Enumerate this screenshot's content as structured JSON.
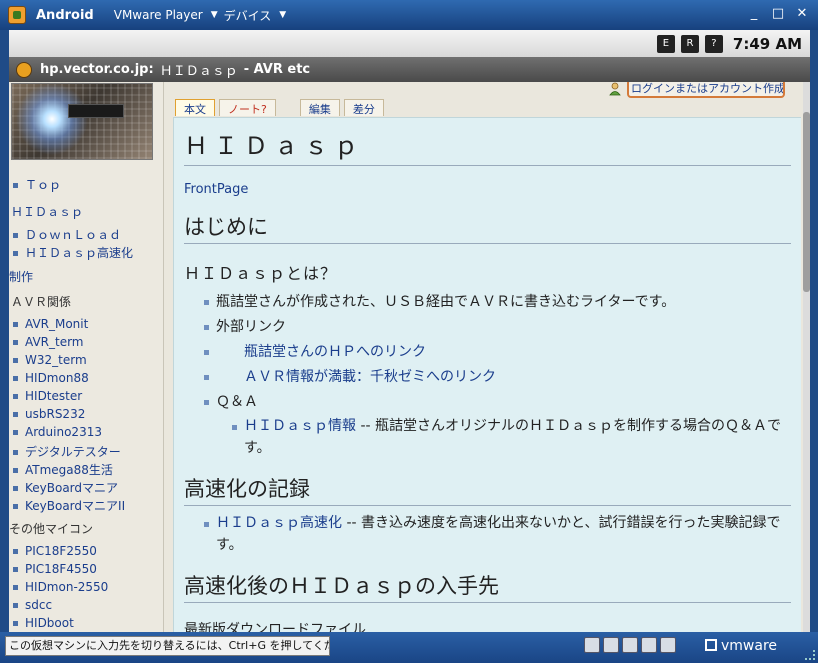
{
  "vm": {
    "title": "Android",
    "menu_player": "VMware Player",
    "menu_devices": "デバイス",
    "hint": "この仮想マシンに入力先を切り替えるには、Ctrl+G を押してください。",
    "logo": "vmware",
    "controls": {
      "minimize": "_",
      "maximize": "□",
      "close": "✕"
    }
  },
  "android": {
    "time": "7:49 AM",
    "icons": [
      "E",
      "R",
      "?"
    ]
  },
  "browser": {
    "domain": "hp.vector.co.jp:",
    "page_title": "ＨＩＤａｓｐ",
    "site_name": "- AVR etc"
  },
  "sidebar": {
    "items": [
      {
        "label": "Ｔｏｐ",
        "bullet": true
      },
      {
        "label": "ＨＩＤａｓｐ",
        "bullet": false
      },
      {
        "label": "ＤｏｗｎＬｏａｄ",
        "bullet": true
      },
      {
        "label": "ＨＩＤａｓｐ高速化",
        "bullet": true
      },
      {
        "label": "制作",
        "bullet": false
      },
      {
        "label": "ＡＶＲ関係",
        "bullet": false,
        "heading": true
      },
      {
        "label": "AVR_Monit",
        "bullet": true
      },
      {
        "label": "AVR_term",
        "bullet": true
      },
      {
        "label": "W32_term",
        "bullet": true
      },
      {
        "label": "HIDmon88",
        "bullet": true
      },
      {
        "label": "HIDtester",
        "bullet": true
      },
      {
        "label": "usbRS232",
        "bullet": true
      },
      {
        "label": "Arduino2313",
        "bullet": true
      },
      {
        "label": "デジタルテスター",
        "bullet": true
      },
      {
        "label": "ATmega88生活",
        "bullet": true
      },
      {
        "label": "KeyBoardマニア",
        "bullet": true
      },
      {
        "label": "KeyBoardマニアII",
        "bullet": true
      },
      {
        "label": "その他マイコン",
        "bullet": false,
        "heading": true
      },
      {
        "label": "PIC18F2550",
        "bullet": true
      },
      {
        "label": "PIC18F4550",
        "bullet": true
      },
      {
        "label": "HIDmon-2550",
        "bullet": true
      },
      {
        "label": "sdcc",
        "bullet": true
      },
      {
        "label": "HIDboot",
        "bullet": true
      }
    ]
  },
  "main": {
    "login": "ログインまたはアカウント作成",
    "tabs": [
      "本文",
      "ノート?",
      "編集",
      "差分"
    ],
    "title": "ＨＩＤａｓｐ",
    "frontpage": "FrontPage",
    "s1_title": "はじめに",
    "s1_sub": "ＨＩＤａｓｐとは？",
    "s1_items": {
      "a": "瓶詰堂さんが作成された、ＵＳＢ経由でＡＶＲに書き込むライターです。",
      "b": "外部リンク",
      "c": "瓶詰堂さんのＨＰへのリンク",
      "d": "ＡＶＲ情報が満載：千秋ゼミへのリンク",
      "e": "Ｑ＆Ａ",
      "f_link": "ＨＩＤａｓｐ情報",
      "f_text": " -- 瓶詰堂さんオリジナルのＨＩＤａｓｐを制作する場合のＱ＆Ａです。"
    },
    "s2_title": "高速化の記録",
    "s2_link": "ＨＩＤａｓｐ高速化",
    "s2_text": " -- 書き込み速度を高速化出来ないかと、試行錯誤を行った実験記録です。",
    "s3_title": "高速化後のＨＩＤａｓｐの入手先",
    "s3_text": "最新版ダウンロードファイル"
  }
}
